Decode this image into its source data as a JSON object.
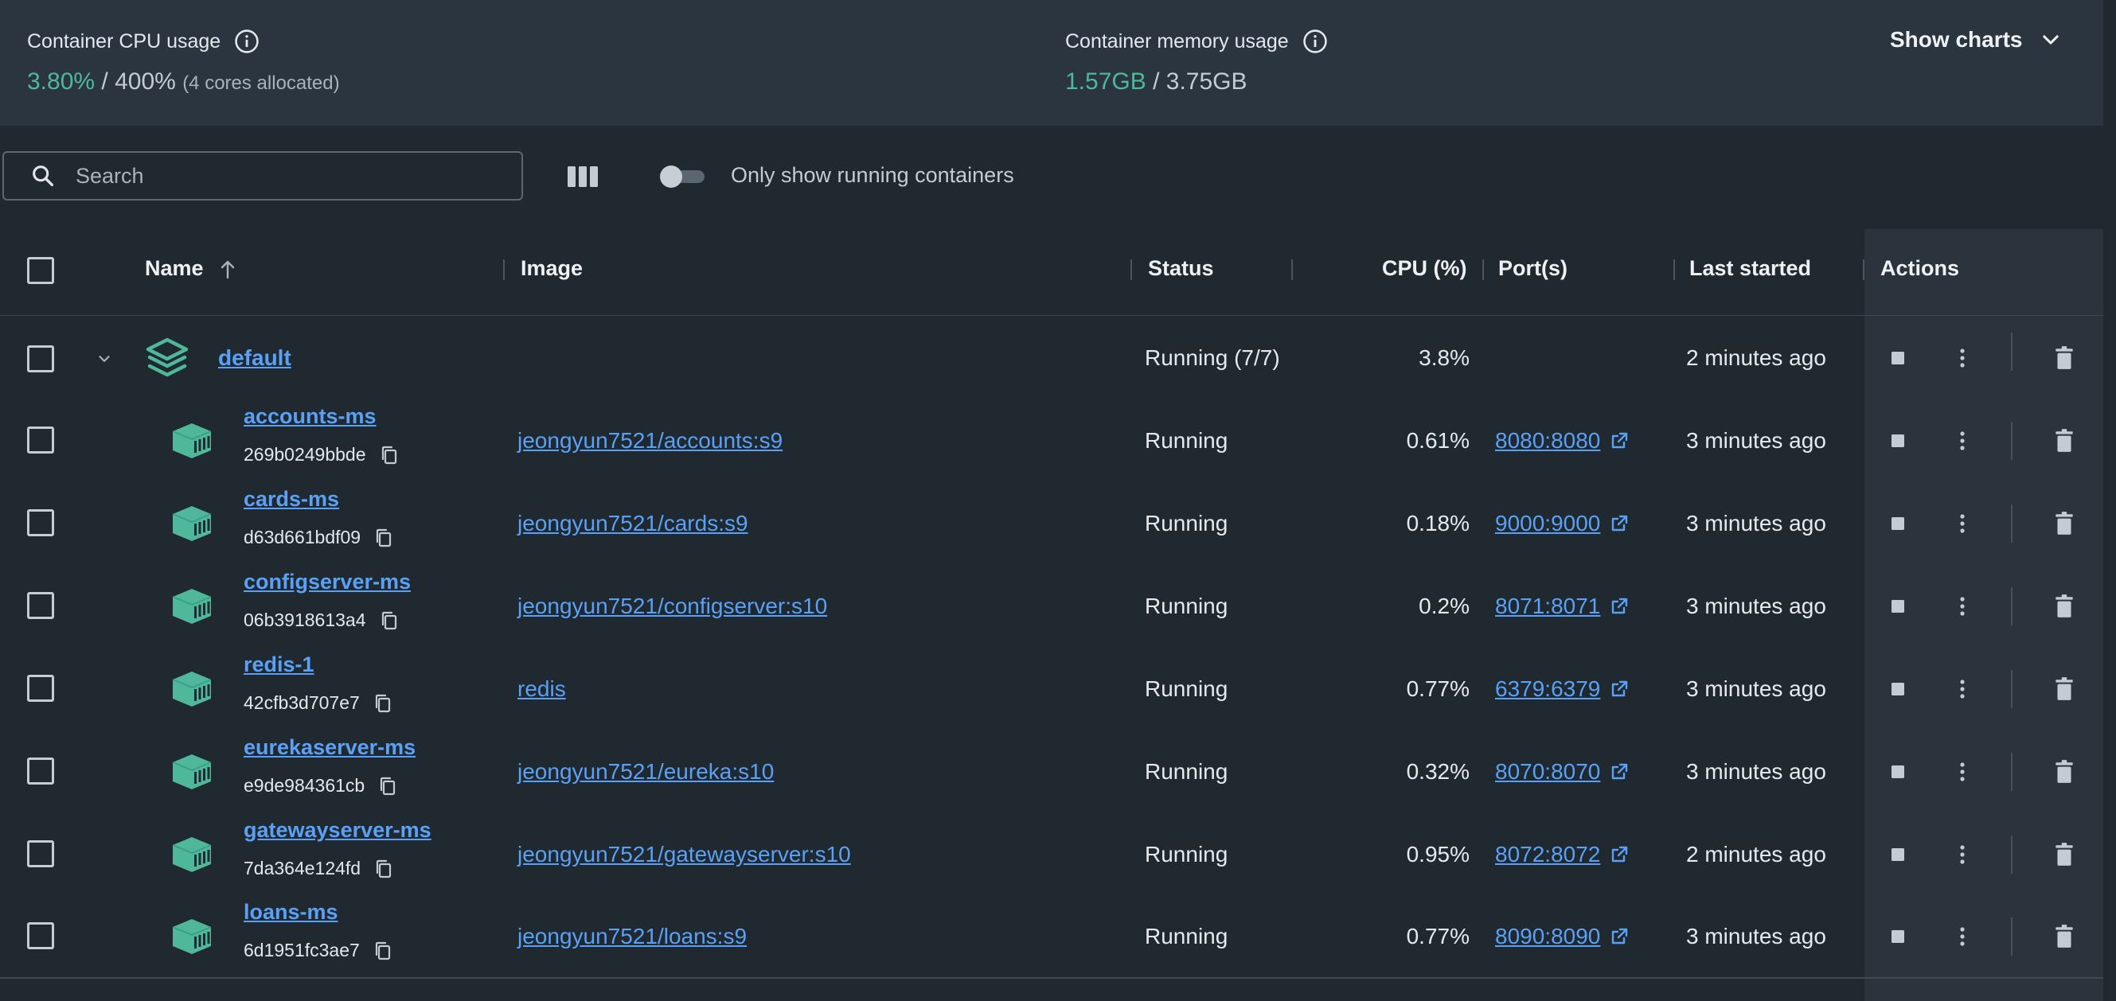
{
  "stats": {
    "cpu_label": "Container CPU usage",
    "cpu_used": "3.80%",
    "cpu_sep": "/",
    "cpu_total": "400%",
    "cpu_note": "(4 cores allocated)",
    "mem_label": "Container memory usage",
    "mem_used": "1.57GB",
    "mem_sep": "/",
    "mem_total": "3.75GB",
    "show_charts": "Show charts"
  },
  "toolbar": {
    "search_placeholder": "Search",
    "toggle_label": "Only show running containers",
    "toggle_on": false
  },
  "table": {
    "headers": {
      "name": "Name",
      "image": "Image",
      "status": "Status",
      "cpu": "CPU (%)",
      "ports": "Port(s)",
      "last_started": "Last started",
      "actions": "Actions"
    },
    "group": {
      "name": "default",
      "status": "Running (7/7)",
      "cpu": "3.8%",
      "last_started": "2 minutes ago"
    },
    "rows": [
      {
        "name": "accounts-ms",
        "id": "269b0249bbde",
        "image": "jeongyun7521/accounts:s9",
        "status": "Running",
        "cpu": "0.61%",
        "ports": "8080:8080",
        "last_started": "3 minutes ago"
      },
      {
        "name": "cards-ms",
        "id": "d63d661bdf09",
        "image": "jeongyun7521/cards:s9",
        "status": "Running",
        "cpu": "0.18%",
        "ports": "9000:9000",
        "last_started": "3 minutes ago"
      },
      {
        "name": "configserver-ms",
        "id": "06b3918613a4",
        "image": "jeongyun7521/configserver:s10",
        "status": "Running",
        "cpu": "0.2%",
        "ports": "8071:8071",
        "last_started": "3 minutes ago"
      },
      {
        "name": "redis-1",
        "id": "42cfb3d707e7",
        "image": "redis",
        "status": "Running",
        "cpu": "0.77%",
        "ports": "6379:6379",
        "last_started": "3 minutes ago"
      },
      {
        "name": "eurekaserver-ms",
        "id": "e9de984361cb",
        "image": "jeongyun7521/eureka:s10",
        "status": "Running",
        "cpu": "0.32%",
        "ports": "8070:8070",
        "last_started": "3 minutes ago"
      },
      {
        "name": "gatewayserver-ms",
        "id": "7da364e124fd",
        "image": "jeongyun7521/gatewayserver:s10",
        "status": "Running",
        "cpu": "0.95%",
        "ports": "8072:8072",
        "last_started": "2 minutes ago"
      },
      {
        "name": "loans-ms",
        "id": "6d1951fc3ae7",
        "image": "jeongyun7521/loans:s9",
        "status": "Running",
        "cpu": "0.77%",
        "ports": "8090:8090",
        "last_started": "3 minutes ago"
      }
    ]
  },
  "icons": {
    "info": "info-icon",
    "chevron": "chevron-down-icon",
    "search": "search-icon",
    "columns": "columns-icon",
    "stack": "stack-icon",
    "container": "container-icon",
    "copy": "copy-icon",
    "external": "external-link-icon",
    "stop": "stop-icon",
    "more": "more-vertical-icon",
    "delete": "trash-icon"
  },
  "colors": {
    "accent_green": "#4fb89a",
    "link_blue": "#5aa1f5",
    "background": "#202830",
    "panel": "#2b3540"
  }
}
